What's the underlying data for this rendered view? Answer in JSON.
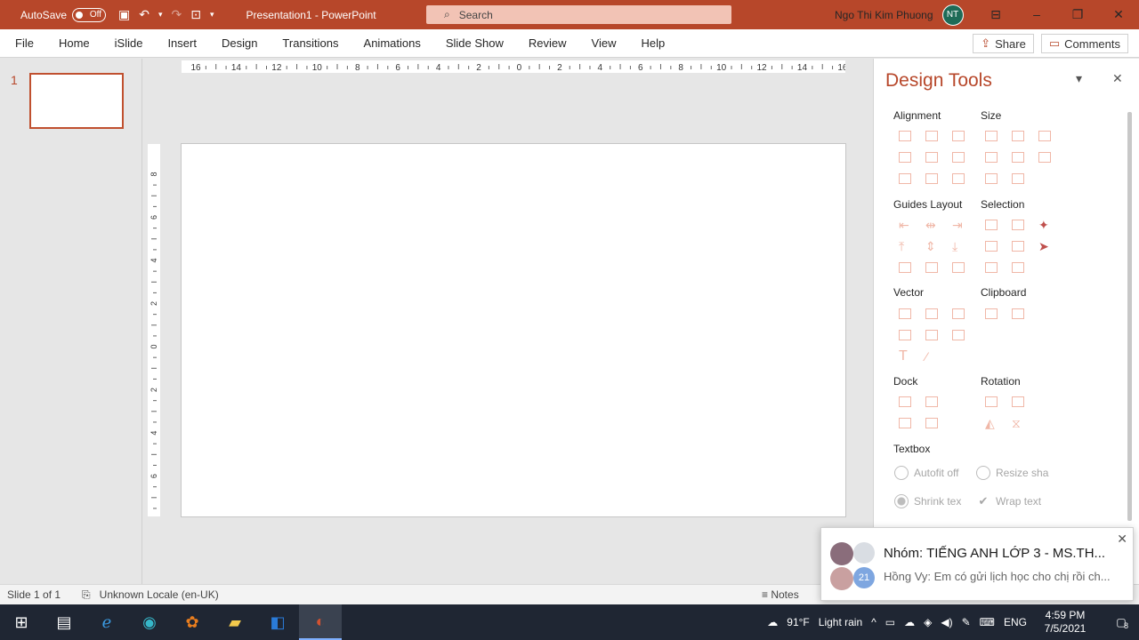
{
  "titlebar": {
    "autosave_label": "AutoSave",
    "autosave_state": "Off",
    "title": "Presentation1  -  PowerPoint",
    "search_placeholder": "Search",
    "user_name": "Ngo Thi Kim Phuong",
    "user_initials": "NT"
  },
  "ribbon": {
    "tabs": [
      "File",
      "Home",
      "iSlide",
      "Insert",
      "Design",
      "Transitions",
      "Animations",
      "Slide Show",
      "Review",
      "View",
      "Help"
    ],
    "share_label": "Share",
    "comments_label": "Comments"
  },
  "thumbnails": {
    "slide_number": "1"
  },
  "ruler": {
    "h_labels": [
      "16",
      "14",
      "12",
      "10",
      "8",
      "6",
      "4",
      "2",
      "0",
      "2",
      "4",
      "6",
      "8",
      "10",
      "12",
      "14",
      "16"
    ],
    "v_labels": [
      "8",
      "6",
      "4",
      "2",
      "0",
      "2",
      "4",
      "6",
      "8"
    ]
  },
  "design_tools": {
    "title": "Design Tools",
    "sections": {
      "alignment": "Alignment",
      "size": "Size",
      "guides_layout": "Guides Layout",
      "selection": "Selection",
      "vector": "Vector",
      "clipboard": "Clipboard",
      "dock": "Dock",
      "rotation": "Rotation",
      "textbox": "Textbox"
    },
    "textbox_options": {
      "autofit_off": "Autofit off",
      "resize_shape": "Resize sha",
      "shrink_text": "Shrink tex",
      "wrap_text": "Wrap text"
    }
  },
  "status": {
    "slide_info": "Slide 1 of 1",
    "locale": "Unknown Locale (en-UK)",
    "notes": "Notes"
  },
  "notification": {
    "group": "Nhóm: TIẾNG ANH LỚP 3 - MS.TH...",
    "message": "Hồng Vy: Em có gửi lịch học cho chị rồi ch...",
    "badge": "21"
  },
  "taskbar": {
    "weather_temp": "91°F",
    "weather_desc": "Light rain",
    "language": "ENG",
    "time": "4:59 PM",
    "date": "7/5/2021",
    "notif_count": "8"
  }
}
